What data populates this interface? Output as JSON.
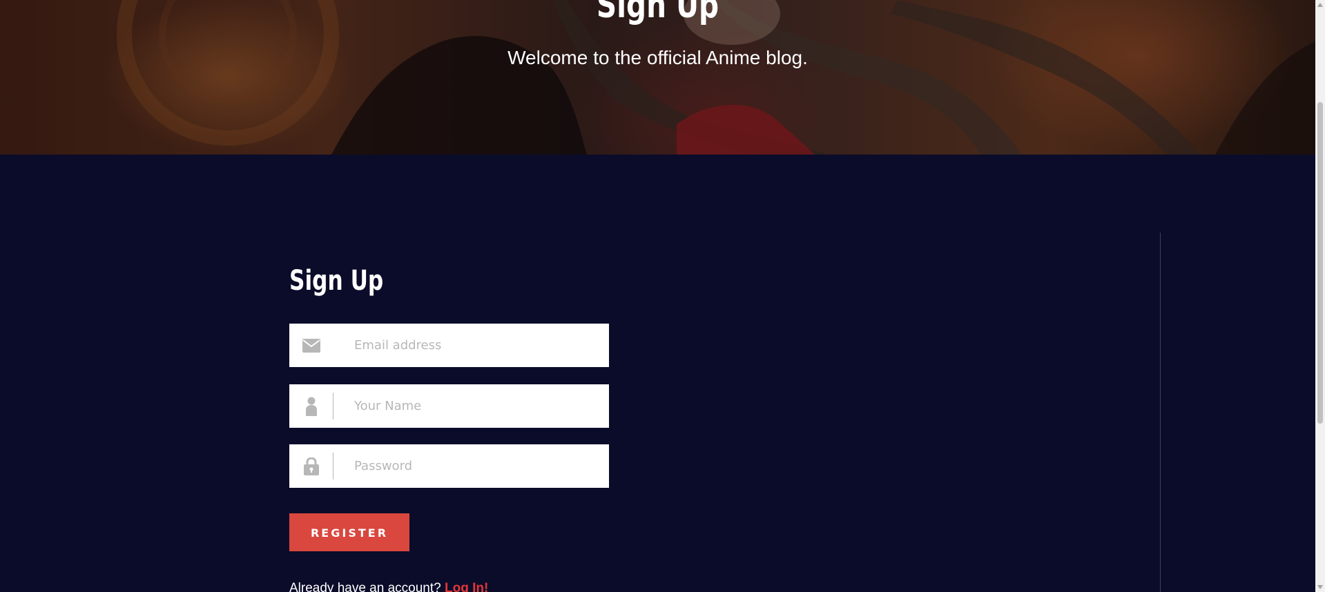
{
  "hero": {
    "title": "Sign Up",
    "subtitle": "Welcome to the official Anime blog."
  },
  "form": {
    "title": "Sign Up",
    "email": {
      "placeholder": "Email address",
      "icon": "envelope-icon"
    },
    "name": {
      "placeholder": "Your Name",
      "icon": "user-icon"
    },
    "password": {
      "placeholder": "Password",
      "icon": "lock-icon"
    },
    "register_label": "REGISTER",
    "login_prompt": "Already have an account?",
    "login_link": "Log In!"
  },
  "colors": {
    "background": "#0b0c2a",
    "accent": "#d9473f",
    "link": "#e53637",
    "icon": "#b7b7b7"
  }
}
